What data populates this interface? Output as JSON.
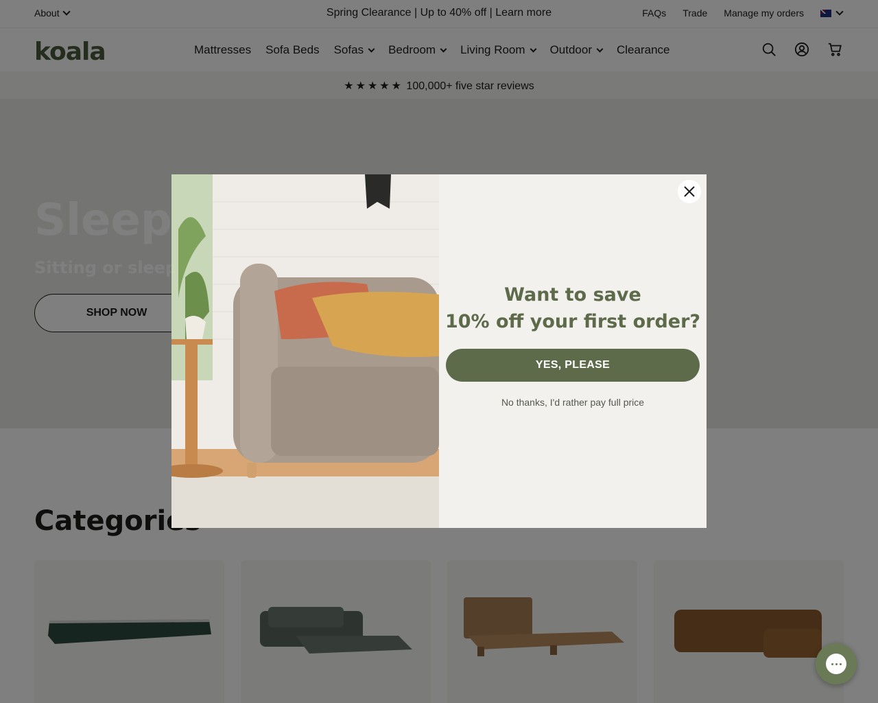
{
  "utility": {
    "about_label": "About",
    "promo_text": "Spring Clearance | Up to 40% off | Learn more",
    "links": [
      "FAQs",
      "Trade",
      "Manage my orders"
    ],
    "flag_icon": "au-flag-icon"
  },
  "header": {
    "logo_text": "koala",
    "nav": [
      {
        "label": "Mattresses",
        "has_menu": false
      },
      {
        "label": "Sofa Beds",
        "has_menu": false
      },
      {
        "label": "Sofas",
        "has_menu": true
      },
      {
        "label": "Bedroom",
        "has_menu": true
      },
      {
        "label": "Living Room",
        "has_menu": true
      },
      {
        "label": "Outdoor",
        "has_menu": true
      },
      {
        "label": "Clearance",
        "has_menu": false
      }
    ],
    "icons": [
      "search-icon",
      "account-icon",
      "cart-icon"
    ]
  },
  "reviews": {
    "stars": "★★★★★",
    "text": "100,000+ five star reviews"
  },
  "hero": {
    "title": "Sleepo",
    "subtitle": "Sitting or sleeping",
    "cta_label": "SHOP NOW"
  },
  "categories": {
    "title": "Categories"
  },
  "modal": {
    "headline_line1": "Want to save",
    "headline_line2": "10% off your first order?",
    "yes_label": "YES, PLEASE",
    "no_label": "No thanks, I'd rather pay full price"
  },
  "colors": {
    "brand_green": "#5e6b4b",
    "modal_bg": "#f2f1ee",
    "overlay": "rgba(0,0,0,0.5)"
  }
}
